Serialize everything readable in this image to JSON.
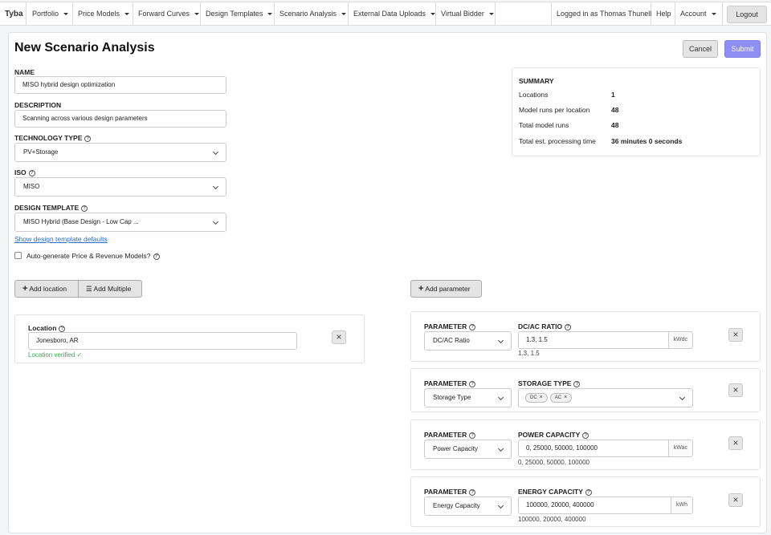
{
  "nav": {
    "brand": "Tyba",
    "items": [
      "Portfolio",
      "Price Models",
      "Forward Curves",
      "Design Templates",
      "Scenario Analysis",
      "External Data Uploads",
      "Virtual Bidder"
    ],
    "user": "Logged in as Thomas Thunell",
    "help": "Help",
    "account": "Account",
    "logout": "Logout"
  },
  "page": {
    "title": "New Scenario Analysis",
    "cancel": "Cancel",
    "submit": "Submit"
  },
  "form": {
    "name_label": "NAME",
    "name_value": "MISO hybrid design optimization",
    "description_label": "DESCRIPTION",
    "description_value": "Scanning across various design parameters",
    "tech_label": "TECHNOLOGY TYPE",
    "tech_value": "PV+Storage",
    "iso_label": "ISO",
    "iso_value": "MISO",
    "template_label": "DESIGN TEMPLATE",
    "template_value": "MISO Hybrid (Base Design - Low Cap ...",
    "show_defaults": "Show design template defaults",
    "autogen_label": "Auto-generate Price & Revenue Models?"
  },
  "summary": {
    "title": "SUMMARY",
    "rows": [
      {
        "label": "Locations",
        "value": "1"
      },
      {
        "label": "Model runs per location",
        "value": "48"
      },
      {
        "label": "Total model runs",
        "value": "48"
      },
      {
        "label": "Total est. processing time",
        "value": "36 minutes 0 seconds"
      }
    ]
  },
  "locations": {
    "add_location": "Add location",
    "add_multiple": "Add Multiple",
    "location_label": "Location",
    "location_value": "Jonesboro, AR",
    "verified": "Location verified ✓"
  },
  "parameters": {
    "add_parameter": "Add parameter",
    "param_label": "PARAMETER",
    "items": [
      {
        "select": "DC/AC Ratio",
        "field_label": "DC/AC RATIO",
        "value": "1.3, 1.5",
        "unit": "kWdc",
        "echo": "1.3, 1.5"
      },
      {
        "select": "Storage Type",
        "field_label": "STORAGE TYPE",
        "tags": [
          "DC",
          "AC"
        ]
      },
      {
        "select": "Power Capacity",
        "field_label": "POWER CAPACITY",
        "value": "0, 25000, 50000, 100000",
        "unit": "kWac",
        "echo": "0, 25000, 50000, 100000"
      },
      {
        "select": "Energy Capacity",
        "field_label": "ENERGY CAPACITY",
        "value": "100000, 20000, 400000",
        "unit": "kWh",
        "echo": "100000, 20000, 400000"
      }
    ]
  },
  "icons": {
    "close": "close-icon",
    "plus": "plus-icon",
    "help": "help-circle-icon",
    "chevron": "chevron-down-icon",
    "caret": "caret-down-icon",
    "stack": "stack-icon"
  }
}
